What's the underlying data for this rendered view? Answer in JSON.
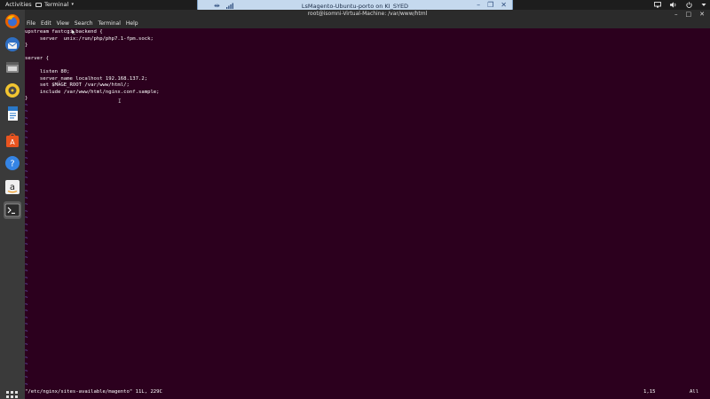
{
  "topbar": {
    "activities": "Activities",
    "app_menu_label": "Terminal",
    "tray_icons": [
      "network-icon",
      "volume-icon",
      "power-icon",
      "chevron-down-icon"
    ]
  },
  "remote_bar": {
    "title": "LsMagento-Ubuntu-porto on KI_SYED"
  },
  "window": {
    "title": "root@isomni-Virtual-Machine: /var/www/html",
    "menu": [
      "File",
      "Edit",
      "View",
      "Search",
      "Terminal",
      "Help"
    ]
  },
  "dock": {
    "items": [
      "firefox-icon",
      "thunderbird-icon",
      "files-icon",
      "rhythmbox-icon",
      "libreoffice-writer-icon",
      "ubuntu-software-icon",
      "help-icon",
      "amazon-icon",
      "terminal-icon"
    ],
    "active": "terminal-icon"
  },
  "editor": {
    "lines": [
      "upstream fastcgi_backend {",
      "     server  unix:/run/php/php7.1-fpm.sock;",
      "}",
      "",
      "server {",
      "",
      "     listen 80;",
      "     server_name localhost 192.168.137.2;",
      "     set $MAGE_ROOT /var/www/html/;",
      "     include /var/www/html/nginx.conf.sample;",
      "}"
    ],
    "tilde": "~",
    "status_file": "\"/etc/nginx/sites-available/magento\" 11L, 229C",
    "status_position": "1,15",
    "status_scroll": "All"
  },
  "colors": {
    "terminal_bg": "#2c001e",
    "tilde": "#7f7fff",
    "dock_bg": "#3a3a3a",
    "topbar_bg": "#1d1d1d"
  }
}
